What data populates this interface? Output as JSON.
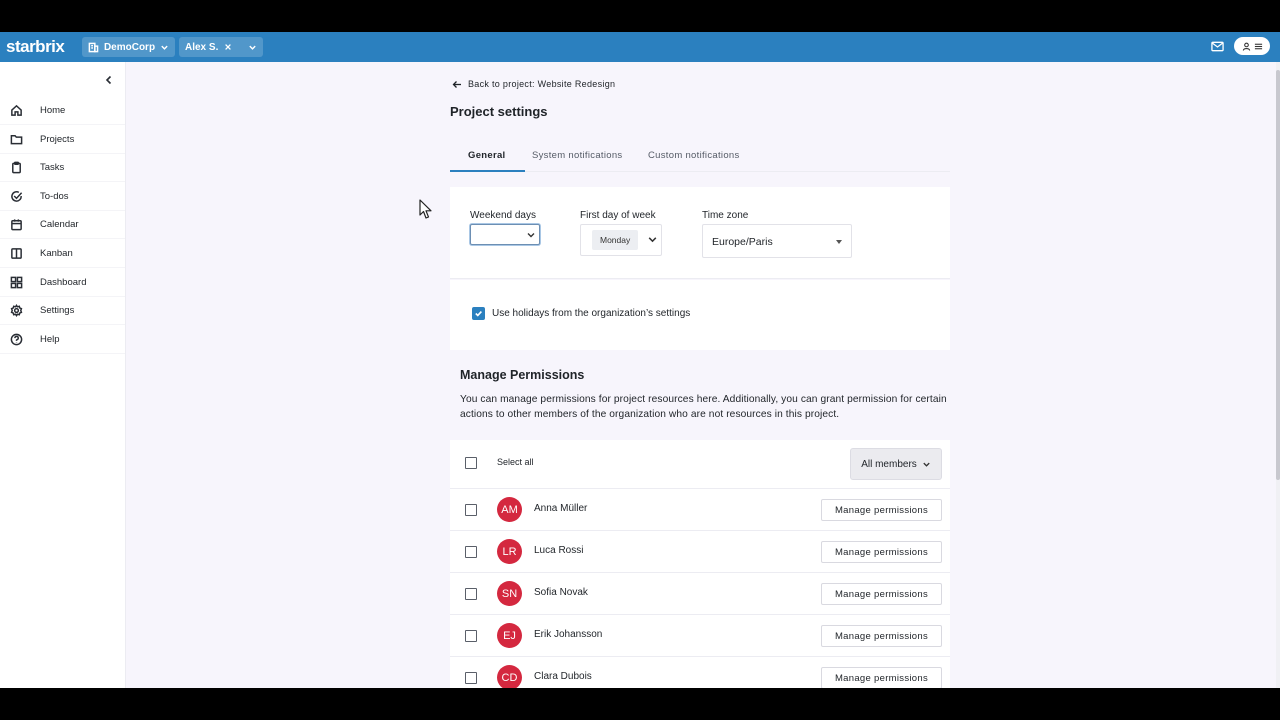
{
  "app": {
    "logo": "starbrix"
  },
  "topbar": {
    "org_chip": "DemoCorp",
    "user_chip": "Alex S."
  },
  "sidebar": {
    "items": [
      {
        "label": "Home",
        "icon": "home-icon"
      },
      {
        "label": "Projects",
        "icon": "folder-icon"
      },
      {
        "label": "Tasks",
        "icon": "clipboard-icon"
      },
      {
        "label": "To-dos",
        "icon": "check-circle-icon"
      },
      {
        "label": "Calendar",
        "icon": "calendar-icon"
      },
      {
        "label": "Kanban",
        "icon": "columns-icon"
      },
      {
        "label": "Dashboard",
        "icon": "grid-icon"
      },
      {
        "label": "Settings",
        "icon": "gear-icon"
      },
      {
        "label": "Help",
        "icon": "help-icon"
      }
    ]
  },
  "page": {
    "back_link": "Back to project: Website Redesign",
    "title": "Project settings",
    "tabs": [
      {
        "label": "General",
        "active": true
      },
      {
        "label": "System notifications",
        "active": false
      },
      {
        "label": "Custom notifications",
        "active": false
      }
    ]
  },
  "general": {
    "weekend_label": "Weekend days",
    "weekend_value": "",
    "first_day_label": "First day of week",
    "first_day_value": "Monday",
    "timezone_label": "Time zone",
    "timezone_value": "Europe/Paris",
    "holidays_label": "Use holidays from the organization’s settings",
    "holidays_checked": true
  },
  "permissions": {
    "title": "Manage Permissions",
    "description": "You can manage permissions for project resources here. Additionally, you can grant permission for certain actions to other members of the organization who are not resources in this project.",
    "select_all": "Select all",
    "filter": "All members",
    "button_label": "Manage permissions",
    "members": [
      {
        "initials": "AM",
        "name": "Anna Müller"
      },
      {
        "initials": "LR",
        "name": "Luca Rossi"
      },
      {
        "initials": "SN",
        "name": "Sofia Novak"
      },
      {
        "initials": "EJ",
        "name": "Erik Johansson"
      },
      {
        "initials": "CD",
        "name": "Clara Dubois"
      }
    ]
  },
  "colors": {
    "brand": "#2b80bf",
    "avatar": "#d4283f",
    "background": "#f7f5fc"
  }
}
